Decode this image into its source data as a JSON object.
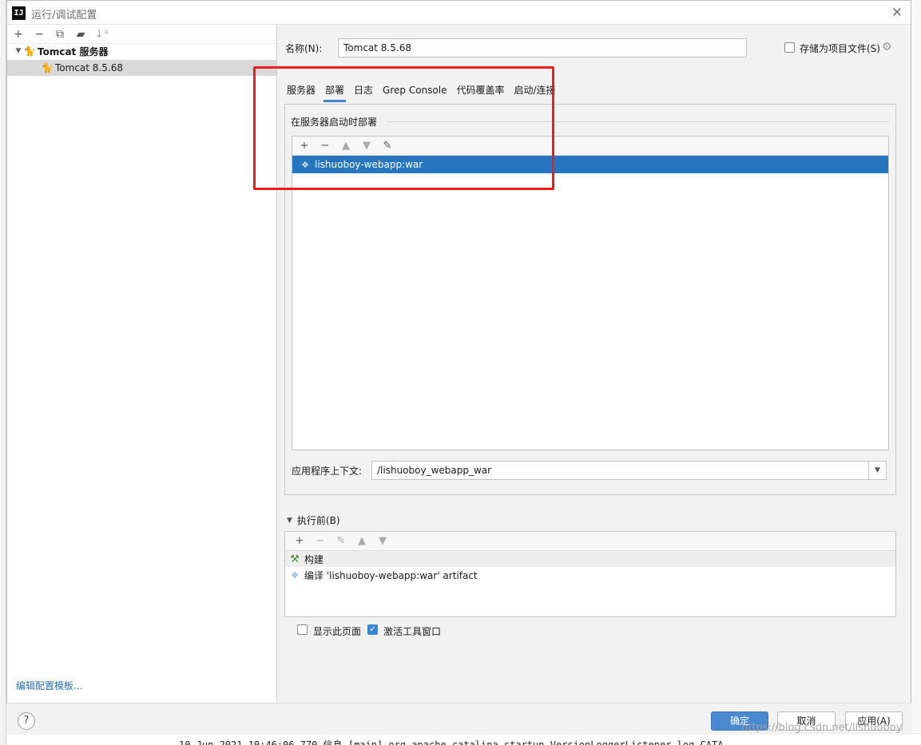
{
  "window": {
    "title": "运行/调试配置"
  },
  "toolbar": {
    "add": "+",
    "remove": "−",
    "copy": "⧉",
    "folder": "▰",
    "sort": "↓ᵃ"
  },
  "tree": {
    "group_label": "Tomcat 服务器",
    "item_label": "Tomcat 8.5.68"
  },
  "left": {
    "edit_templates": "编辑配置模板..."
  },
  "form": {
    "name_label": "名称(N):",
    "name_value": "Tomcat 8.5.68",
    "store_label": "存储为项目文件(S)"
  },
  "tabs": [
    "服务器",
    "部署",
    "日志",
    "Grep Console",
    "代码覆盖率",
    "启动/连接"
  ],
  "deploy": {
    "section_title": "在服务器启动时部署",
    "artifacts": [
      "lishuoboy-webapp:war"
    ],
    "context_label": "应用程序上下文:",
    "context_value": "/lishuoboy_webapp_war"
  },
  "before_launch": {
    "title": "执行前(B)",
    "items": [
      "构建",
      "编译 'lishuoboy-webapp:war' artifact"
    ]
  },
  "options": {
    "show_page": "显示此页面",
    "activate_tool_window": "激活工具窗口"
  },
  "buttons": {
    "ok": "确定",
    "cancel": "取消",
    "apply": "应用(A)",
    "help": "?"
  },
  "watermark": "https://blog.csdn.net/lishuoboy",
  "console_fragment": "10-Jun-2021 10:46:06.770 信息 [main] org.apache.catalina.startup.VersionLoggerListener.log CATA",
  "colors": {
    "accent": "#2675bf",
    "primary_button": "#4a89cf",
    "highlight_frame": "#ee1c1c"
  }
}
